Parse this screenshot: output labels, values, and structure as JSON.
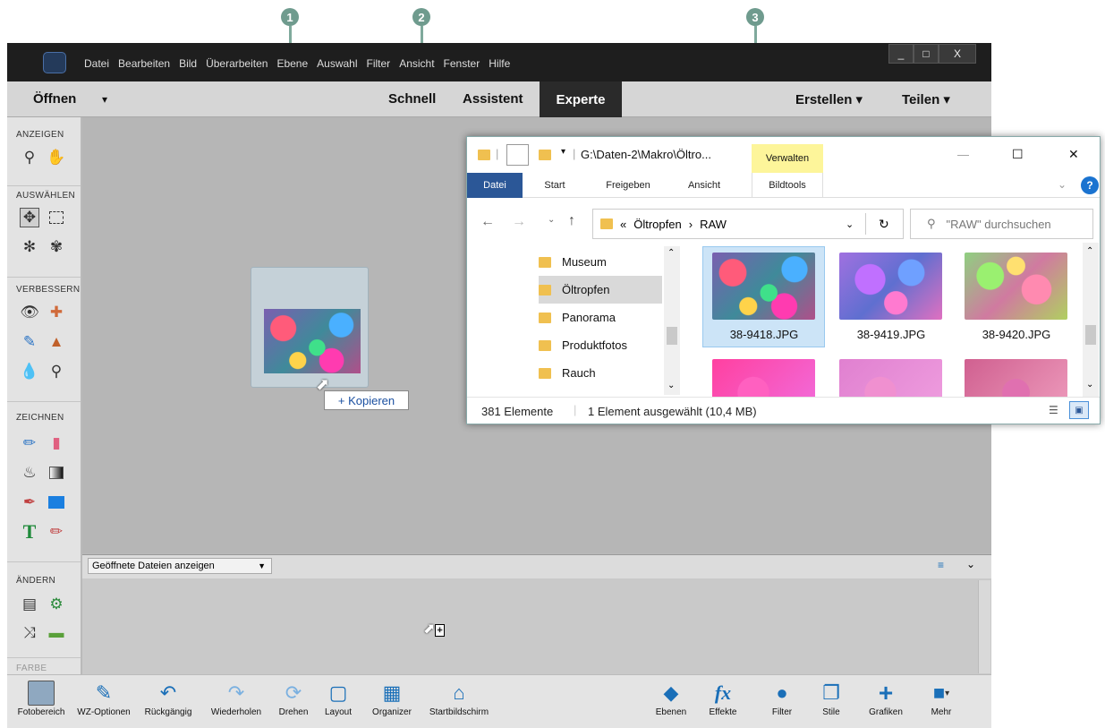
{
  "callouts": [
    "1",
    "2",
    "3"
  ],
  "menubar": {
    "items": [
      "Datei",
      "Bearbeiten",
      "Bild",
      "Überarbeiten",
      "Ebene",
      "Auswahl",
      "Filter",
      "Ansicht",
      "Fenster",
      "Hilfe"
    ],
    "window_buttons": [
      "_",
      "□",
      "X"
    ]
  },
  "modebar": {
    "open_label": "Öffnen",
    "open_arrow": "▾",
    "modes": [
      "Schnell",
      "Assistent",
      "Experte"
    ],
    "active_mode": "Experte",
    "create_label": "Erstellen ▾",
    "share_label": "Teilen ▾"
  },
  "toolbox": {
    "sections": [
      "ANZEIGEN",
      "AUSWÄHLEN",
      "VERBESSERN",
      "ZEICHNEN",
      "ÄNDERN",
      "FARBE"
    ]
  },
  "canvas": {
    "copy_tooltip": "+ Kopieren"
  },
  "panel": {
    "dropdown_label": "Geöffnete Dateien anzeigen"
  },
  "bottombar": {
    "left": [
      {
        "label": "Fotobereich",
        "icon": "photo-bin-icon"
      },
      {
        "label": "WZ-Optionen",
        "icon": "tool-options-icon"
      },
      {
        "label": "Rückgängig",
        "icon": "undo-icon"
      },
      {
        "label": "Wiederholen",
        "icon": "redo-icon"
      },
      {
        "label": "Drehen",
        "icon": "rotate-icon"
      },
      {
        "label": "Layout",
        "icon": "layout-icon"
      },
      {
        "label": "Organizer",
        "icon": "organizer-icon"
      },
      {
        "label": "Startbildschirm",
        "icon": "home-icon"
      }
    ],
    "right": [
      {
        "label": "Ebenen",
        "icon": "layers-icon"
      },
      {
        "label": "Effekte",
        "icon": "fx-icon"
      },
      {
        "label": "Filter",
        "icon": "filter-icon"
      },
      {
        "label": "Stile",
        "icon": "styles-icon"
      },
      {
        "label": "Grafiken",
        "icon": "graphics-icon"
      },
      {
        "label": "Mehr",
        "icon": "more-icon"
      }
    ]
  },
  "explorer": {
    "title_path": "G:\\Daten-2\\Makro\\Öltro...",
    "context_tab": "Verwalten",
    "ribbon_tabs": [
      "Datei",
      "Start",
      "Freigeben",
      "Ansicht",
      "Bildtools"
    ],
    "window_buttons": [
      "—",
      "☐",
      "✕"
    ],
    "breadcrumb_prefix": "«",
    "breadcrumb": [
      "Öltropfen",
      "RAW"
    ],
    "search_placeholder": "\"RAW\" durchsuchen",
    "nav_items": [
      "Museum",
      "Öltropfen",
      "Panorama",
      "Produktfotos",
      "Rauch"
    ],
    "selected_nav": "Öltropfen",
    "files": [
      "38-9418.JPG",
      "38-9419.JPG",
      "38-9420.JPG"
    ],
    "selected_file": "38-9418.JPG",
    "status_count": "381 Elemente",
    "status_selection": "1 Element ausgewählt (10,4 MB)"
  },
  "colors": {
    "accent_blue": "#1a6fb8",
    "callout_green": "#6f9b8e",
    "selection_blue": "#cce4f7",
    "dark_bar": "#1e1e1e"
  }
}
